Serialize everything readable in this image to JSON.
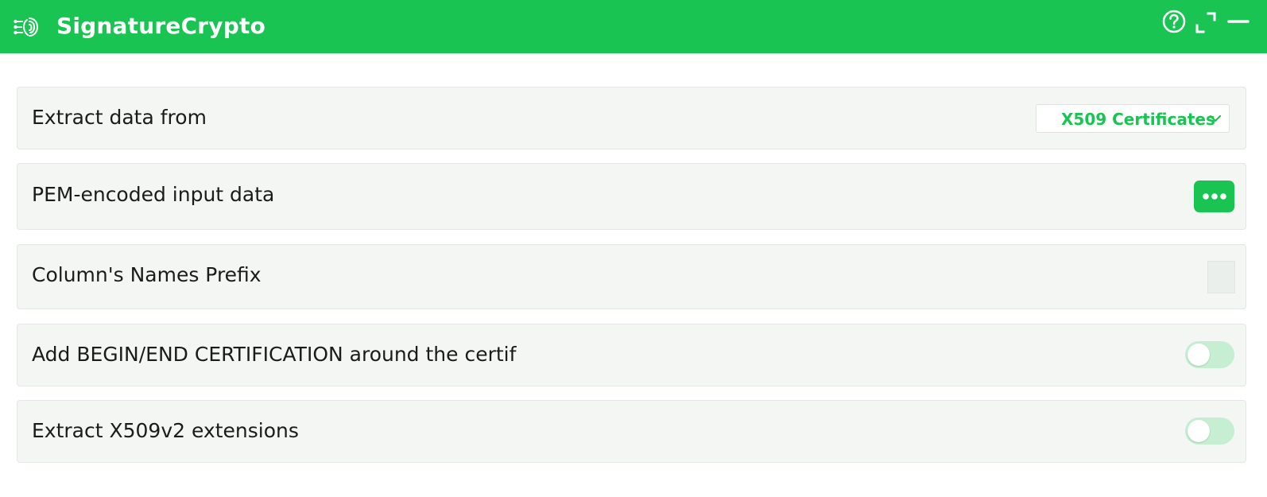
{
  "app": {
    "title": "SignatureCrypto",
    "accent_color": "#1ac452",
    "logo_icon": "fingerprint-circuit-icon",
    "window_controls": [
      "help-icon",
      "fullscreen-icon",
      "minimize-icon"
    ]
  },
  "fields": {
    "extract_from": {
      "label": "Extract data from",
      "selected": "X509 Certificates"
    },
    "pem_input": {
      "label": "PEM-encoded input data",
      "button_icon": "more-options-icon"
    },
    "prefix": {
      "label": "Column's Names Prefix",
      "value": ""
    },
    "add_begin_end": {
      "label": "Add BEGIN/END CERTIFICATION around the certif",
      "enabled": false
    },
    "extract_v2": {
      "label": "Extract X509v2 extensions",
      "enabled": false
    }
  }
}
